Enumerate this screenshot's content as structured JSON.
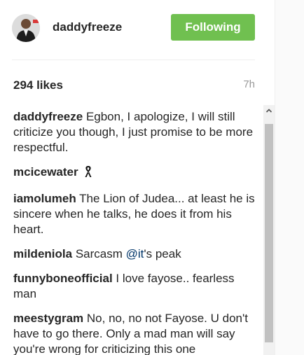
{
  "header": {
    "username": "daddyfreeze",
    "follow_button_label": "Following"
  },
  "post": {
    "likes": "294 likes",
    "time": "7h"
  },
  "comments": [
    {
      "user": "daddyfreeze",
      "text": "Egbon, I apologize, I will still criticize you though, I just promise to be more respectful."
    },
    {
      "user": "mcicewater",
      "text": "",
      "icon": "ribbon-icon"
    },
    {
      "user": "iamolumeh",
      "text": "The Lion of Judea... at least he is sincere when he talks, he does it from his heart."
    },
    {
      "user": "mildeniola",
      "text_before": "Sarcasm ",
      "mention": "@it",
      "text_after": "'s peak"
    },
    {
      "user": "funnyboneofficial",
      "text": "I love fayose.. fearless man"
    },
    {
      "user": "meestygram",
      "text": "No, no, no not Fayose. U don't have to go there. Only a mad man will say you're wrong for criticizing this one"
    }
  ],
  "colors": {
    "follow_button": "#70c050",
    "text": "#262626",
    "muted": "#999999",
    "mention": "#003569"
  }
}
